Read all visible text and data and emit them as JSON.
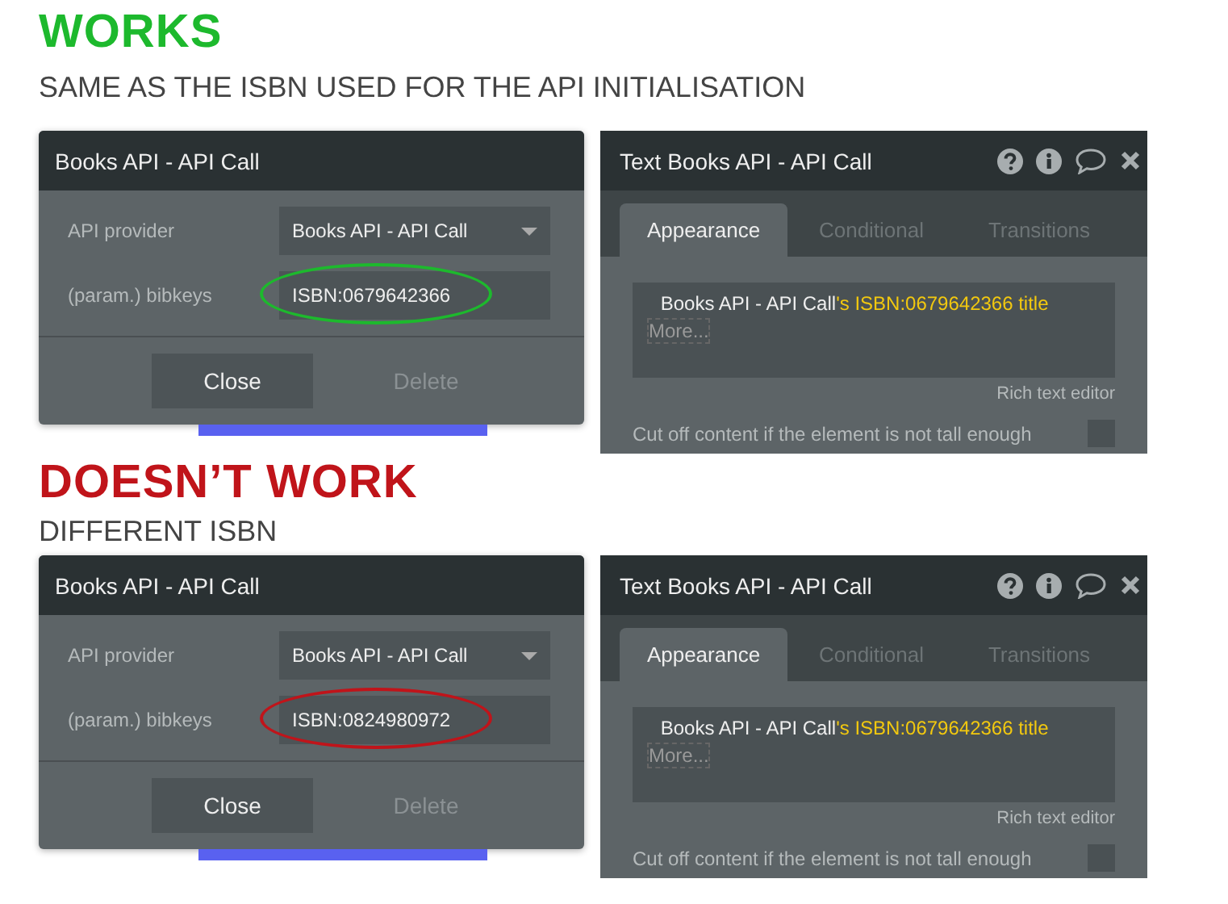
{
  "sections": [
    {
      "heading": "WORKS",
      "subheading": "SAME AS THE ISBN USED FOR THE API INITIALISATION",
      "color": "#1db92d",
      "dialog": {
        "title": "Books API - API Call",
        "fields": [
          {
            "kind": "dropdown",
            "label": "API provider",
            "value": "Books API - API Call",
            "circled": false
          },
          {
            "kind": "text",
            "label": "(param.) bibkeys",
            "value": "ISBN:0679642366",
            "circled": true
          }
        ],
        "buttons": [
          {
            "label": "Close",
            "disabled": false
          },
          {
            "label": "Delete",
            "disabled": true
          }
        ]
      },
      "editor": {
        "title": "Text Books API - API Call",
        "tabs": [
          {
            "label": "Appearance",
            "selected": true
          },
          {
            "label": "Conditional",
            "selected": false
          },
          {
            "label": "Transitions",
            "selected": false
          }
        ],
        "source": "Books API - API Call",
        "expression": "'s ISBN:0679642366 title",
        "more": "More...",
        "hint": "Rich text editor",
        "option": {
          "label": "Cut off content if the element is not tall enough",
          "checked": false
        }
      }
    },
    {
      "heading": "DOESN’T WORK",
      "subheading": "DIFFERENT ISBN",
      "color": "#c0141a",
      "dialog": {
        "title": "Books API - API Call",
        "fields": [
          {
            "kind": "dropdown",
            "label": "API provider",
            "value": "Books API - API Call",
            "circled": false
          },
          {
            "kind": "text",
            "label": "(param.) bibkeys",
            "value": "ISBN:0824980972",
            "circled": true
          }
        ],
        "buttons": [
          {
            "label": "Close",
            "disabled": false
          },
          {
            "label": "Delete",
            "disabled": true
          }
        ]
      },
      "editor": {
        "title": "Text Books API - API Call",
        "tabs": [
          {
            "label": "Appearance",
            "selected": true
          },
          {
            "label": "Conditional",
            "selected": false
          },
          {
            "label": "Transitions",
            "selected": false
          }
        ],
        "source": "Books API - API Call",
        "expression": "'s ISBN:0679642366 title",
        "more": "More...",
        "hint": "Rich text editor",
        "option": {
          "label": "Cut off content if the element is not tall enough",
          "checked": false
        }
      }
    }
  ]
}
